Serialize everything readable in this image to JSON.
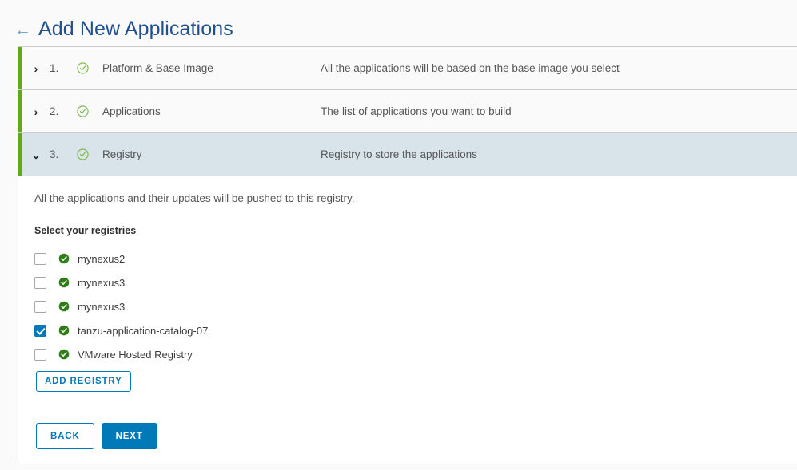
{
  "header": {
    "back_icon": "arrow-left-icon",
    "back_arrow_glyph": "←",
    "title": "Add New Applications",
    "title_color": "#21508c",
    "arrow_color": "#6a9bc3"
  },
  "wizard": {
    "accent_stripe_color": "#60a917",
    "active_row_background": "#d8e3ea",
    "steps": [
      {
        "number": "1.",
        "chevron": "›",
        "state_icon": "check-circle-outline-icon",
        "label": "Platform & Base Image",
        "description": "All the applications will be based on the base image you select",
        "expanded": false
      },
      {
        "number": "2.",
        "chevron": "›",
        "state_icon": "check-circle-outline-icon",
        "label": "Applications",
        "description": "The list of applications you want to build",
        "expanded": false
      },
      {
        "number": "3.",
        "chevron": "⌄",
        "state_icon": "check-circle-outline-icon",
        "label": "Registry",
        "description": "Registry to store the applications",
        "expanded": true
      }
    ]
  },
  "panel": {
    "intro": "All the applications and their updates will be pushed to this registry.",
    "sublabel": "Select your registries",
    "registries": [
      {
        "name": "mynexus2",
        "checked": false,
        "status_icon": "check-circle-filled-icon",
        "status_color": "#2e7d17"
      },
      {
        "name": "mynexus3",
        "checked": false,
        "status_icon": "check-circle-filled-icon",
        "status_color": "#2e7d17"
      },
      {
        "name": "mynexus3",
        "checked": false,
        "status_icon": "check-circle-filled-icon",
        "status_color": "#2e7d17"
      },
      {
        "name": "tanzu-application-catalog-07",
        "checked": true,
        "status_icon": "check-circle-filled-icon",
        "status_color": "#2e7d17"
      },
      {
        "name": "VMware Hosted Registry",
        "checked": false,
        "status_icon": "check-circle-filled-icon",
        "status_color": "#2e7d17"
      }
    ],
    "add_registry_label": "ADD REGISTRY",
    "back_label": "BACK",
    "next_label": "NEXT",
    "accent_blue": "#0079b8"
  }
}
